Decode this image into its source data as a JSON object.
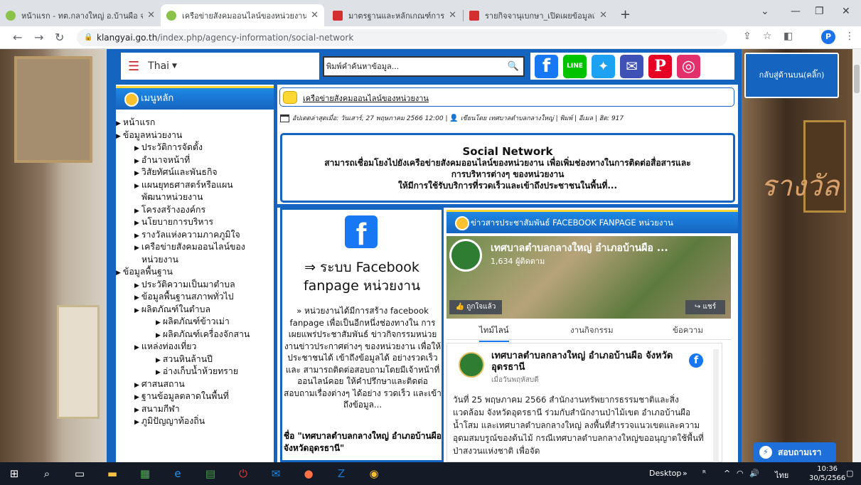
{
  "browser": {
    "tabs": [
      {
        "title": "หน้าแรก - ทต.กลางใหญ่ อ.บ้านผือ จ.อุ",
        "favicon_color": "#8bc34a"
      },
      {
        "title": "เครือข่ายสังคมออนไลน์ของหน่วยงาน -",
        "favicon_color": "#8bc34a"
      },
      {
        "title": "มาตรฐานและหลักเกณฑ์การเปิดเผยข้อ",
        "favicon_color": "#d32f2f"
      },
      {
        "title": "รายกิจจานุเบกษา_เปิดเผยข้อมูลเปิดภ",
        "favicon_color": "#d32f2f"
      }
    ],
    "url_domain": "klangyai.go.th",
    "url_path": "/index.php/agency-information/social-network",
    "profile_initial": "P"
  },
  "header": {
    "language": "Thai",
    "search_placeholder": "พิมพ์คำค้นหาข้อมูล...",
    "social": [
      {
        "icon": "facebook-icon",
        "glyph": "f",
        "color": "#1877f2"
      },
      {
        "icon": "line-icon",
        "glyph": "LINE",
        "color": "#00c300"
      },
      {
        "icon": "twitter-icon",
        "glyph": "🐦",
        "color": "#1da1f2"
      },
      {
        "icon": "email-icon",
        "glyph": "✉",
        "color": "#3f51b5"
      },
      {
        "icon": "pinterest-icon",
        "glyph": "P",
        "color": "#e60023"
      },
      {
        "icon": "instagram-icon",
        "glyph": "◎",
        "color": "#e1306c"
      }
    ]
  },
  "side_buttons": {
    "back_to_top": "กลับสู่ด้านบน(คลิ๊ก)",
    "chat": "สอบถามเรา"
  },
  "sidebar": {
    "title": "เมนูหลัก",
    "items": [
      {
        "label": "หน้าแรก",
        "level": 0
      },
      {
        "label": "ข้อมูลหน่วยงาน",
        "level": 0
      },
      {
        "label": "ประวัติการจัดตั้ง",
        "level": 1
      },
      {
        "label": "อำนาจหน้าที่",
        "level": 1
      },
      {
        "label": "วิสัยทัศน์และพันธกิจ",
        "level": 1
      },
      {
        "label": "แผนยุทธศาสตร์หรือแผน",
        "level": 1
      },
      {
        "label": "พัฒนาหน่วยงาน",
        "level": 9
      },
      {
        "label": "โครงสร้างองค์กร",
        "level": 1
      },
      {
        "label": "นโยบายการบริหาร",
        "level": 1
      },
      {
        "label": "รางวัลแห่งความภาคภูมิใจ",
        "level": 1
      },
      {
        "label": "เครือข่ายสังคมออนไลน์ของ",
        "level": 1
      },
      {
        "label": "หน่วยงาน",
        "level": 9
      },
      {
        "label": "ข้อมูลพื้นฐาน",
        "level": 0
      },
      {
        "label": "ประวัติความเป็นมาตำบล",
        "level": 1
      },
      {
        "label": "ข้อมูลพื้นฐานสภาพทั่วไป",
        "level": 1
      },
      {
        "label": "ผลิตภัณฑ์ในตำบล",
        "level": 1
      },
      {
        "label": "ผลิตภัณฑ์ข้าวเม่า",
        "level": 2
      },
      {
        "label": "ผลิตภัณฑ์เครื่องจักสาน",
        "level": 2
      },
      {
        "label": "แหล่งท่องเที่ยว",
        "level": 1
      },
      {
        "label": "สวนหินล้านปี",
        "level": 2
      },
      {
        "label": "อ่างเก็บน้ำห้วยทราย",
        "level": 2
      },
      {
        "label": "ศาสนสถาน",
        "level": 1
      },
      {
        "label": "ฐานข้อมูลตลาดในพื้นที่",
        "level": 1
      },
      {
        "label": "สนามกีฬา",
        "level": 1
      },
      {
        "label": "ภูมิปัญญาท้องถิ่น",
        "level": 1
      }
    ]
  },
  "content": {
    "breadcrumb": "เครือข่ายสังคมออนไลน์ของหน่วยงาน",
    "meta": "อัปเดตล่าสุดเมื่อ: วันเสาร์, 27 พฤษภาคม 2566 12:00 |",
    "meta_author": "เขียนโดย เทศบาลตำบลกลางใหญ่ | พิมพ์ | อีเมล | ฮิต: 917",
    "intro_title": "Social Network",
    "intro_line1": "สามารถเชื่อมโยงไปยังเครือข่ายสังคมออนไลน์ของหน่วยงาน เพื่อเพิ่มช่องทางในการติดต่อสื่อสารและ",
    "intro_line2": "การบริหารต่างๆ ของหน่วยงาน",
    "intro_line3": "ให้มีการใช้รับบริการที่รวดเร็วและเข้าถึงประชาชนในพื้นที่...",
    "fb_title": "⇒ ระบบ Facebook fanpage หน่วยงาน",
    "fb_text": "» หน่วยงานได้มีการสร้าง facebook fanpage เพื่อเป็นอีกหนึ่งช่องทางใน การเผยแพร่ประชาสัมพันธ์ ข่าวกิจกรรมหน่วย งานข่าวประกาศต่างๆ ของหน่วยงาน เพื่อให้ประชาชนได้ เข้าถึงข้อมูลได้ อย่างรวดเร็วและ สามารถติดต่อสอบถามโดยมีเจ้าหน้าที่ ออนไลน์คอย ให้คำปรึกษาและติดต่อ สอบถามเรื่องต่างๆ ได้อย่าง รวดเร็ว และเข้าถึงข้อมูล...",
    "fb_name": "ชื่อ \"เทศบาลตำบลกลางใหญ่ อำเภอบ้านผือ จังหวัดอุดรธานี\"",
    "news_head": "ข่าวสารประชาสัมพันธ์ FACEBOOK FANPAGE หน่วยงาน",
    "page_name": "เทศบาลตำบลกลางใหญ่ อำเภอบ้านผือ ...",
    "followers": "1,634 ผู้ติดตาม",
    "liked": "ถูกใจแล้ว",
    "share": "แชร์",
    "fb_tabs": [
      "ไทม์ไลน์",
      "งานกิจกรรม",
      "ข้อความ"
    ],
    "post_name": "เทศบาลตำบลกลางใหญ่ อำเภอบ้านผือ จังหวัดอุดรธานี",
    "post_date": "เมื่อวันพฤหัสบดี",
    "post_body": "วันที่ 25 พฤษภาคม 2566 สำนักงานทรัพยากรธรรมชาติและสิ่งแวดล้อม จังหวัดอุดรธานี ร่วมกับสำนักงานป่าไม้เขต อำเภอบ้านผือ น้ำโสม และเทศบาลตำบลกลางใหญ่ ลงพื้นที่สำรวจแนวเขตและความอุดมสมบรูณ์ของต้นไม้ กรณีเทศบาลตำบลกลางใหญ่ขออนุญาตใช้พื้นที่ป่าสงวนแห่งชาติ เพื่อจัด"
  },
  "taskbar": {
    "desktop_label": "Desktop",
    "ime": "ไทย",
    "time": "10:36",
    "date": "30/5/2566"
  }
}
